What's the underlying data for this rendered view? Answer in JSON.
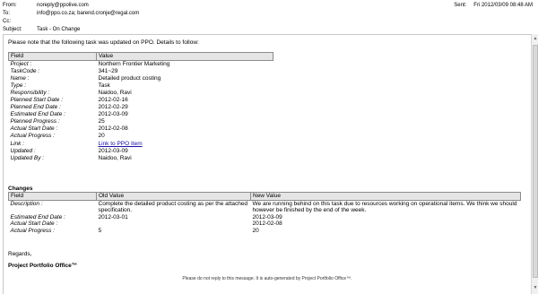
{
  "header": {
    "from_label": "From:",
    "from_value": "noreply@ppolive.com",
    "to_label": "To:",
    "to_value": "info@ppo.co.za; barend.cronje@regal.com",
    "cc_label": "Cc:",
    "cc_value": "",
    "subject_label": "Subject:",
    "subject_value": "Task - On Change",
    "sent_label": "Sent:",
    "sent_value": "Fri 2012/03/09 08:48 AM"
  },
  "body": {
    "intro": "Please note that the following task was updated on PPO. Details to follow:",
    "task_table": {
      "headers": [
        "Field",
        "Value"
      ],
      "rows": [
        {
          "field": "Project :",
          "value": "Northern Frontier Marketing"
        },
        {
          "field": "TaskCode :",
          "value": "341~29"
        },
        {
          "field": "Name :",
          "value": "Detailed product costing"
        },
        {
          "field": "Type :",
          "value": "Task"
        },
        {
          "field": "Responsibility :",
          "value": "Naidoo, Ravi"
        },
        {
          "field": "Planned Start Date :",
          "value": "2012-02-16"
        },
        {
          "field": "Planned End Date :",
          "value": "2012-02-29"
        },
        {
          "field": "Estimated End Date :",
          "value": "2012-03-09"
        },
        {
          "field": "Planned Progress :",
          "value": "25"
        },
        {
          "field": "Actual Start Date :",
          "value": "2012-02-08"
        },
        {
          "field": "Actual Progress :",
          "value": "20"
        },
        {
          "field": "Link :",
          "value": "Link to PPO Item"
        },
        {
          "field": "Updated :",
          "value": "2012-03-09"
        },
        {
          "field": "Updated By :",
          "value": "Naidoo, Ravi"
        }
      ]
    },
    "changes_title": "Changes",
    "changes_table": {
      "headers": [
        "Field",
        "Old Value",
        "New Value"
      ],
      "rows": [
        {
          "field": "Description :",
          "old": "Complete the detailed product costing as per the attached specification.",
          "new": "We are running behind on this task due to resources working on operational items. We think we should however be finished by the end of the week."
        },
        {
          "field": "Estimated End Date :",
          "old": "2012-03-01",
          "new": "2012-03-09"
        },
        {
          "field": "Actual Start Date :",
          "old": "",
          "new": "2012-02-08"
        },
        {
          "field": "Actual Progress :",
          "old": "5",
          "new": "20"
        }
      ]
    },
    "regards": "Regards,",
    "signature": "Project Portfolio Office™",
    "footer": "Please do not reply to this message. It is auto-generated by Project Portfolio Office™."
  },
  "icons": {
    "scroll_up": "chevron-up-icon",
    "scroll_down": "chevron-down-icon"
  }
}
